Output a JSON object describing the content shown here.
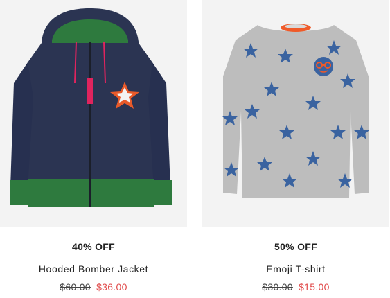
{
  "products": [
    {
      "image_alt": "Hooded Bomber Jacket",
      "discount": "40% OFF",
      "title": "Hooded Bomber Jacket",
      "old_price": "$60.00",
      "new_price": "$36.00"
    },
    {
      "image_alt": "Emoji T-shirt",
      "discount": "50% OFF",
      "title": "Emoji T-shirt",
      "old_price": "$30.00",
      "new_price": "$15.00"
    }
  ],
  "colors": {
    "image_bg": "#f3f3f3",
    "text": "#222222",
    "sale_price": "#e14b4b",
    "jacket_navy": "#2b3452",
    "jacket_green": "#2e7a3e",
    "shirt_grey": "#bdbdbd",
    "star_blue": "#3a63a0"
  }
}
